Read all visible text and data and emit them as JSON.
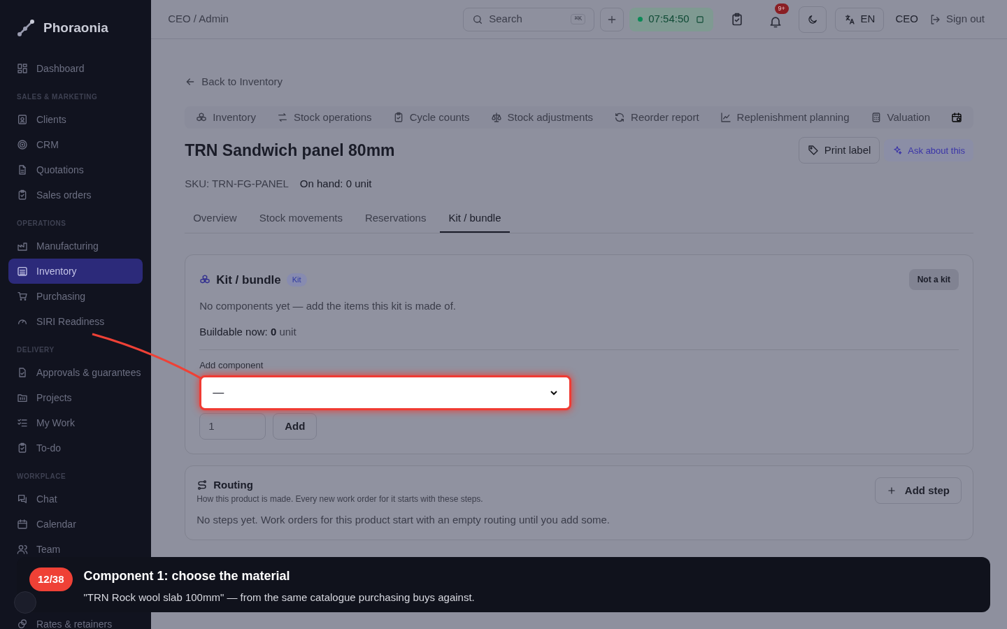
{
  "brand": "Phoraonia",
  "sidebar": {
    "sections": [
      {
        "items": [
          {
            "label": "Dashboard",
            "selected": false
          }
        ]
      },
      {
        "heading": "SALES & MARKETING",
        "items": [
          {
            "label": "Clients",
            "selected": false
          },
          {
            "label": "CRM",
            "selected": false
          },
          {
            "label": "Quotations",
            "selected": false
          },
          {
            "label": "Sales orders",
            "selected": false
          }
        ]
      },
      {
        "heading": "OPERATIONS",
        "items": [
          {
            "label": "Manufacturing",
            "selected": false
          },
          {
            "label": "Inventory",
            "selected": true
          },
          {
            "label": "Purchasing",
            "selected": false
          },
          {
            "label": "SIRI Readiness",
            "selected": false
          }
        ]
      },
      {
        "heading": "DELIVERY",
        "items": [
          {
            "label": "Approvals & guarantees",
            "selected": false
          },
          {
            "label": "Projects",
            "selected": false
          },
          {
            "label": "My Work",
            "selected": false
          },
          {
            "label": "To-do",
            "selected": false
          }
        ]
      },
      {
        "heading": "WORKPLACE",
        "items": [
          {
            "label": "Chat",
            "selected": false
          },
          {
            "label": "Calendar",
            "selected": false
          },
          {
            "label": "Team",
            "selected": false
          },
          {
            "label": "Rates & retainers",
            "selected": false
          }
        ]
      }
    ]
  },
  "topbar": {
    "breadcrumb": "CEO / Admin",
    "search": {
      "placeholder": "Search",
      "shortcut": "⌘K"
    },
    "timer": "07:54:50",
    "notifications_badge": "9+",
    "language": "EN",
    "user": "CEO",
    "sign_out": "Sign out"
  },
  "back_link": "Back to Inventory",
  "module_tabs": [
    "Inventory",
    "Stock operations",
    "Cycle counts",
    "Stock adjustments",
    "Reorder report",
    "Replenishment planning",
    "Valuation"
  ],
  "product": {
    "title": "TRN Sandwich panel 80mm",
    "sku": "SKU: TRN-FG-PANEL",
    "on_hand": "On hand: 0 unit",
    "actions": {
      "print": "Print label",
      "ask": "Ask about this"
    }
  },
  "tabs": [
    {
      "label": "Overview",
      "selected": false
    },
    {
      "label": "Stock movements",
      "selected": false
    },
    {
      "label": "Reservations",
      "selected": false
    },
    {
      "label": "Kit / bundle",
      "selected": true
    }
  ],
  "kit": {
    "title": "Kit / bundle",
    "badge": "Kit",
    "status_button": "Not a kit",
    "empty": "No components yet — add the items this kit is made of.",
    "buildable_label": "Buildable now:",
    "buildable_value": "0",
    "buildable_unit": "unit",
    "add_label": "Add component",
    "select_value": "—",
    "quantity": "1",
    "add_button": "Add"
  },
  "routing": {
    "title": "Routing",
    "subtitle": "How this product is made. Every new work order for it starts with these steps.",
    "add_button": "Add step",
    "empty": "No steps yet. Work orders for this product start with an empty routing until you add some."
  },
  "tour": {
    "step": "12/38",
    "title": "Component 1: choose the material",
    "body": "\"TRN Rock wool slab 100mm\" — from the same catalogue purchasing buys against."
  }
}
